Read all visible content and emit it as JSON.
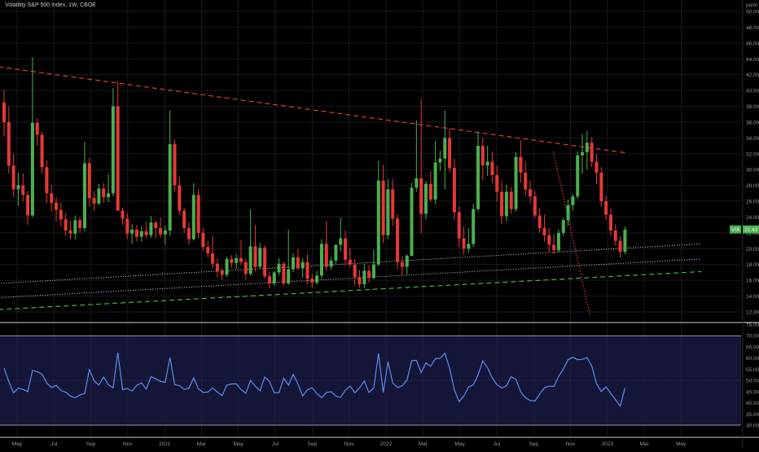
{
  "header": {
    "title": "Volatility S&P 500 Index, 1W, CBOE",
    "unit_label": "point"
  },
  "colors": {
    "background": "#000000",
    "grid": "#1a1a1f",
    "up": "#4caf50",
    "down": "#e53935",
    "trend_red": "#e53935",
    "trend_green": "#4caf50",
    "trend_white": "#d7d7d7",
    "rsi_line": "#5b8def",
    "rsi_band": "#1c1c4a",
    "axis_text": "#9598a1",
    "price_tag": "#4caf50"
  },
  "chart_data": [
    {
      "type": "candlestick",
      "title": "Volatility S&P 500 Index, 1W, CBOE",
      "ylabel": "point",
      "ylim": [
        11,
        52
      ],
      "y_ticks": [
        "12.00",
        "14.00",
        "16.00",
        "18.00",
        "20.00",
        "22.00",
        "24.00",
        "26.00",
        "28.00",
        "30.00",
        "32.00",
        "34.00",
        "36.00",
        "38.00",
        "40.00",
        "42.00",
        "44.00",
        "46.00",
        "48.00",
        "50.00"
      ],
      "x_ticks": [
        "May",
        "Jul",
        "Sep",
        "Nov",
        "2021",
        "Mar",
        "May",
        "Jul",
        "Sep",
        "Nov",
        "2022",
        "Mar",
        "May",
        "Jul",
        "Sep",
        "Nov",
        "2023",
        "Mar",
        "May"
      ],
      "last_price": {
        "symbol": "VIX",
        "value": "22.43"
      },
      "candles": [
        [
          38.5,
          40.1,
          34.2,
          36.0
        ],
        [
          36.0,
          38.0,
          29.5,
          30.5
        ],
        [
          30.5,
          32.0,
          26.5,
          27.5
        ],
        [
          27.5,
          29.6,
          25.4,
          28.0
        ],
        [
          28.0,
          29.5,
          26.0,
          26.8
        ],
        [
          26.8,
          27.3,
          23.0,
          24.2
        ],
        [
          24.2,
          44.2,
          24.0,
          35.9
        ],
        [
          35.9,
          36.5,
          33.0,
          34.4
        ],
        [
          34.4,
          34.8,
          29.5,
          30.3
        ],
        [
          30.3,
          31.2,
          25.8,
          27.0
        ],
        [
          27.0,
          28.0,
          24.7,
          25.8
        ],
        [
          25.8,
          26.5,
          23.4,
          24.9
        ],
        [
          24.9,
          25.8,
          22.8,
          23.7
        ],
        [
          23.7,
          24.5,
          21.6,
          22.3
        ],
        [
          22.3,
          23.6,
          21.2,
          21.9
        ],
        [
          21.9,
          24.2,
          21.2,
          23.6
        ],
        [
          23.6,
          24.0,
          22.0,
          22.6
        ],
        [
          22.6,
          33.5,
          22.2,
          30.8
        ],
        [
          30.8,
          31.5,
          25.3,
          26.4
        ],
        [
          26.4,
          27.3,
          24.8,
          25.7
        ],
        [
          25.7,
          28.2,
          25.5,
          27.6
        ],
        [
          27.6,
          28.3,
          25.8,
          26.5
        ],
        [
          26.5,
          29.4,
          25.9,
          27.0
        ],
        [
          27.0,
          40.3,
          26.6,
          38.0
        ],
        [
          38.0,
          41.2,
          27.0,
          24.8
        ],
        [
          24.8,
          25.2,
          23.0,
          23.8
        ],
        [
          23.8,
          24.5,
          21.2,
          21.9
        ],
        [
          21.9,
          23.1,
          20.6,
          22.4
        ],
        [
          22.4,
          23.0,
          20.9,
          21.5
        ],
        [
          21.5,
          22.8,
          20.9,
          22.2
        ],
        [
          22.2,
          23.4,
          21.3,
          21.7
        ],
        [
          21.7,
          24.1,
          21.4,
          23.3
        ],
        [
          23.3,
          23.6,
          21.3,
          22.6
        ],
        [
          22.6,
          23.9,
          21.4,
          21.8
        ],
        [
          21.8,
          22.9,
          20.5,
          22.3
        ],
        [
          22.3,
          37.5,
          21.6,
          33.2
        ],
        [
          33.2,
          33.8,
          27.2,
          28.0
        ],
        [
          28.0,
          29.1,
          24.3,
          24.8
        ],
        [
          24.8,
          25.1,
          22.0,
          22.6
        ],
        [
          22.6,
          23.3,
          20.5,
          21.2
        ],
        [
          21.2,
          28.3,
          21.0,
          26.8
        ],
        [
          26.8,
          27.6,
          21.3,
          22.0
        ],
        [
          22.0,
          22.6,
          19.7,
          20.2
        ],
        [
          20.2,
          21.0,
          18.9,
          19.4
        ],
        [
          19.4,
          21.6,
          17.5,
          18.1
        ],
        [
          18.1,
          18.8,
          16.4,
          17.2
        ],
        [
          17.2,
          17.6,
          16.0,
          16.7
        ],
        [
          16.7,
          19.0,
          16.4,
          18.7
        ],
        [
          18.7,
          19.2,
          17.6,
          18.2
        ],
        [
          18.2,
          19.3,
          17.4,
          18.8
        ],
        [
          18.8,
          21.1,
          17.9,
          18.3
        ],
        [
          18.3,
          18.8,
          16.1,
          16.8
        ],
        [
          16.8,
          25.0,
          16.6,
          20.3
        ],
        [
          20.3,
          23.0,
          17.1,
          17.7
        ],
        [
          17.7,
          20.7,
          17.5,
          20.1
        ],
        [
          20.1,
          20.4,
          16.2,
          16.5
        ],
        [
          16.5,
          17.1,
          15.0,
          15.6
        ],
        [
          15.6,
          17.2,
          15.3,
          17.0
        ],
        [
          17.0,
          18.8,
          16.6,
          18.1
        ],
        [
          18.1,
          18.3,
          15.3,
          15.6
        ],
        [
          15.6,
          22.4,
          15.4,
          17.4
        ],
        [
          17.4,
          19.4,
          17.0,
          18.9
        ],
        [
          18.9,
          19.9,
          17.3,
          17.5
        ],
        [
          17.5,
          18.8,
          16.3,
          18.3
        ],
        [
          18.3,
          19.3,
          15.5,
          16.2
        ],
        [
          16.2,
          16.8,
          15.1,
          15.7
        ],
        [
          15.7,
          17.2,
          15.4,
          16.6
        ],
        [
          16.6,
          21.2,
          16.2,
          20.6
        ],
        [
          20.6,
          23.5,
          17.2,
          17.7
        ],
        [
          17.7,
          18.9,
          17.3,
          18.5
        ],
        [
          18.5,
          20.4,
          18.1,
          20.5
        ],
        [
          20.5,
          23.9,
          19.6,
          21.3
        ],
        [
          21.3,
          22.3,
          17.8,
          18.6
        ],
        [
          18.6,
          20.1,
          17.6,
          18.0
        ],
        [
          18.0,
          18.7,
          15.3,
          16.4
        ],
        [
          16.4,
          17.3,
          15.1,
          15.5
        ],
        [
          15.5,
          18.1,
          15.0,
          17.2
        ],
        [
          17.2,
          17.9,
          15.7,
          16.3
        ],
        [
          16.3,
          19.9,
          16.1,
          18.0
        ],
        [
          18.0,
          31.1,
          17.8,
          28.6
        ],
        [
          28.6,
          30.6,
          20.7,
          21.7
        ],
        [
          21.7,
          28.8,
          21.2,
          27.5
        ],
        [
          27.5,
          28.8,
          22.9,
          23.8
        ],
        [
          23.8,
          24.4,
          17.4,
          18.3
        ],
        [
          18.3,
          19.1,
          16.6,
          17.7
        ],
        [
          17.7,
          19.3,
          16.7,
          19.1
        ],
        [
          19.1,
          28.3,
          19.0,
          27.7
        ],
        [
          27.7,
          36.2,
          27.2,
          28.9
        ],
        [
          28.9,
          38.9,
          21.9,
          24.4
        ],
        [
          24.4,
          28.6,
          23.7,
          28.2
        ],
        [
          28.2,
          29.8,
          25.9,
          26.2
        ],
        [
          26.2,
          33.6,
          25.6,
          30.9
        ],
        [
          30.9,
          32.4,
          29.8,
          31.4
        ],
        [
          31.4,
          37.5,
          27.5,
          34.0
        ],
        [
          34.0,
          35.2,
          29.6,
          30.2
        ],
        [
          30.2,
          31.4,
          23.7,
          24.6
        ],
        [
          24.6,
          25.3,
          20.2,
          21.3
        ],
        [
          21.3,
          22.8,
          19.2,
          20.0
        ],
        [
          20.0,
          22.6,
          19.5,
          20.6
        ],
        [
          20.6,
          25.7,
          20.2,
          25.0
        ],
        [
          25.0,
          34.8,
          24.7,
          33.0
        ],
        [
          33.0,
          34.0,
          28.6,
          30.5
        ],
        [
          30.5,
          33.0,
          29.2,
          31.0
        ],
        [
          31.0,
          32.3,
          28.3,
          29.3
        ],
        [
          29.3,
          30.5,
          25.9,
          27.2
        ],
        [
          27.2,
          28.6,
          23.1,
          24.1
        ],
        [
          24.1,
          28.1,
          23.4,
          27.2
        ],
        [
          27.2,
          27.8,
          24.4,
          25.0
        ],
        [
          25.0,
          32.2,
          24.7,
          31.6
        ],
        [
          31.6,
          33.7,
          28.3,
          29.6
        ],
        [
          29.6,
          31.0,
          26.7,
          27.5
        ],
        [
          27.5,
          28.6,
          25.7,
          26.6
        ],
        [
          26.6,
          27.3,
          23.9,
          24.2
        ],
        [
          24.2,
          25.2,
          22.0,
          22.6
        ],
        [
          22.6,
          24.3,
          20.9,
          21.7
        ],
        [
          21.7,
          22.6,
          19.6,
          20.5
        ],
        [
          20.5,
          21.8,
          19.3,
          19.8
        ],
        [
          19.8,
          22.4,
          19.5,
          22.0
        ],
        [
          22.0,
          23.9,
          21.6,
          23.6
        ],
        [
          23.6,
          26.2,
          22.9,
          25.5
        ],
        [
          25.5,
          26.9,
          24.8,
          26.6
        ],
        [
          26.6,
          32.3,
          26.3,
          31.8
        ],
        [
          31.8,
          34.5,
          29.5,
          32.2
        ],
        [
          32.2,
          34.9,
          30.0,
          33.4
        ],
        [
          33.4,
          34.1,
          30.3,
          31.0
        ],
        [
          31.0,
          32.0,
          28.2,
          29.6
        ],
        [
          29.6,
          30.3,
          25.3,
          26.0
        ],
        [
          26.0,
          26.7,
          23.6,
          24.3
        ],
        [
          24.3,
          25.1,
          21.6,
          22.3
        ],
        [
          22.3,
          23.1,
          20.4,
          21.0
        ],
        [
          21.0,
          21.6,
          18.9,
          19.6
        ],
        [
          19.6,
          22.8,
          19.3,
          22.4
        ]
      ],
      "trendlines": [
        {
          "style": "red-dashed",
          "points": [
            [
              "Apr 2020",
              43.0
            ],
            [
              "Feb 2023",
              32.1
            ]
          ]
        },
        {
          "style": "red-dotted",
          "points": [
            [
              "Oct 2022",
              32.3
            ],
            [
              "Dec 2022",
              11.5
            ]
          ]
        },
        {
          "style": "white-dotted",
          "points": [
            [
              "Apr 2020",
              13.8
            ],
            [
              "Jun 2023",
              18.7
            ]
          ]
        },
        {
          "style": "white-dotted-upper",
          "points": [
            [
              "Apr 2020",
              15.6
            ],
            [
              "Jun 2023",
              20.6
            ]
          ]
        },
        {
          "style": "green-dashed",
          "points": [
            [
              "Apr 2020",
              12.3
            ],
            [
              "Jun 2023",
              17.1
            ]
          ]
        }
      ]
    },
    {
      "type": "line",
      "name": "RSI",
      "ylim": [
        27,
        75
      ],
      "y_ticks": [
        "30.00",
        "35.00",
        "40.00",
        "45.00",
        "50.00",
        "55.00",
        "60.00",
        "65.00",
        "70.00",
        "75.00"
      ],
      "band": [
        30,
        70
      ],
      "values": [
        55.5,
        49.5,
        44.5,
        46.5,
        46.0,
        45.0,
        54.5,
        53.9,
        52.8,
        48.9,
        46.8,
        47.8,
        45.5,
        44.7,
        43.0,
        42.2,
        43.5,
        44.1,
        54.9,
        49.8,
        47.9,
        51.5,
        48.1,
        46.7,
        62.5,
        45.9,
        46.4,
        45.2,
        47.8,
        48.9,
        46.1,
        51.7,
        50.7,
        49.6,
        49.1,
        60.3,
        48.1,
        47.7,
        46.0,
        46.5,
        51.2,
        46.3,
        44.6,
        44.8,
        46.6,
        44.8,
        43.2,
        47.9,
        48.4,
        48.5,
        45.9,
        44.2,
        50.0,
        47.4,
        45.4,
        51.5,
        49.5,
        44.5,
        44.5,
        51.0,
        47.9,
        52.7,
        48.4,
        43.1,
        45.8,
        46.7,
        44.1,
        42.3,
        44.5,
        45.0,
        43.0,
        42.4,
        45.6,
        47.5,
        44.5,
        46.7,
        49.7,
        44.6,
        46.7,
        62.1,
        44.6,
        58.3,
        48.9,
        46.8,
        47.6,
        50.2,
        58.8,
        59.0,
        53.5,
        57.8,
        56.3,
        59.7,
        59.9,
        62.2,
        55.4,
        45.7,
        40.5,
        43.0,
        47.0,
        48.0,
        52.4,
        58.8,
        55.7,
        51.1,
        48.1,
        46.6,
        47.6,
        51.7,
        50.4,
        44.9,
        42.3,
        41.0,
        40.8,
        43.9,
        46.7,
        47.5,
        47.3,
        51.8,
        55.1,
        59.3,
        60.4,
        59.3,
        59.4,
        60.2,
        56.4,
        48.5,
        45.0,
        47.1,
        44.2,
        41.4,
        38.5,
        46.6
      ]
    }
  ]
}
